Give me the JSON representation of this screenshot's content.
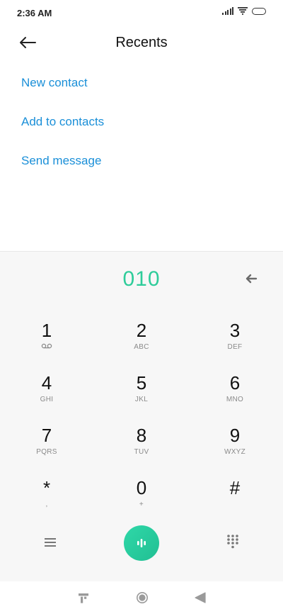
{
  "status_bar": {
    "time": "2:36 AM",
    "icons": [
      "signal-icon",
      "wifi-icon",
      "battery-icon"
    ]
  },
  "header": {
    "title": "Recents",
    "back_icon": "arrow-left-icon"
  },
  "actions": [
    {
      "label": "New contact"
    },
    {
      "label": "Add to contacts"
    },
    {
      "label": "Send message"
    }
  ],
  "dialer": {
    "number": "010",
    "accent_color": "#2ecc9a",
    "keys": [
      {
        "digit": "1",
        "letters": "",
        "sub_icon": "voicemail-icon"
      },
      {
        "digit": "2",
        "letters": "ABC"
      },
      {
        "digit": "3",
        "letters": "DEF"
      },
      {
        "digit": "4",
        "letters": "GHI"
      },
      {
        "digit": "5",
        "letters": "JKL"
      },
      {
        "digit": "6",
        "letters": "MNO"
      },
      {
        "digit": "7",
        "letters": "PQRS"
      },
      {
        "digit": "8",
        "letters": "TUV"
      },
      {
        "digit": "9",
        "letters": "WXYZ"
      },
      {
        "digit": "*",
        "letters": ","
      },
      {
        "digit": "0",
        "letters": "+"
      },
      {
        "digit": "#",
        "letters": ""
      }
    ],
    "bottom_icons": [
      "menu-icon",
      "call-icon",
      "keypad-icon"
    ]
  },
  "nav_bar": {
    "icons": [
      "recents-icon",
      "home-icon",
      "back-icon"
    ]
  }
}
